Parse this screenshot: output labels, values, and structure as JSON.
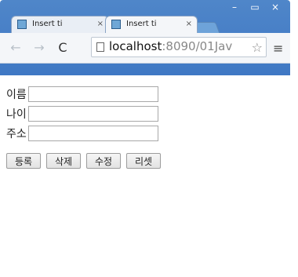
{
  "colors": {
    "titlebar": "#3f78c4",
    "toolbar": "#f4f6f9",
    "content": "#ffffff"
  },
  "tabs": [
    {
      "label": "Insert ti",
      "favicon": "page-icon"
    },
    {
      "label": "Insert ti",
      "favicon": "page-icon"
    }
  ],
  "tab_close_glyph": "×",
  "window_buttons": {
    "minimize": "–",
    "maximize": "▭",
    "close": "×"
  },
  "toolbar": {
    "back": "←",
    "forward": "→",
    "reload": "C",
    "url_host": "localhost",
    "url_path": ":8090/01Jav",
    "star": "☆",
    "menu": "≡"
  },
  "form": {
    "fields": [
      {
        "label": "이름",
        "value": ""
      },
      {
        "label": "나이",
        "value": ""
      },
      {
        "label": "주소",
        "value": ""
      }
    ],
    "buttons": [
      "등록",
      "삭제",
      "수정",
      "리셋"
    ]
  }
}
